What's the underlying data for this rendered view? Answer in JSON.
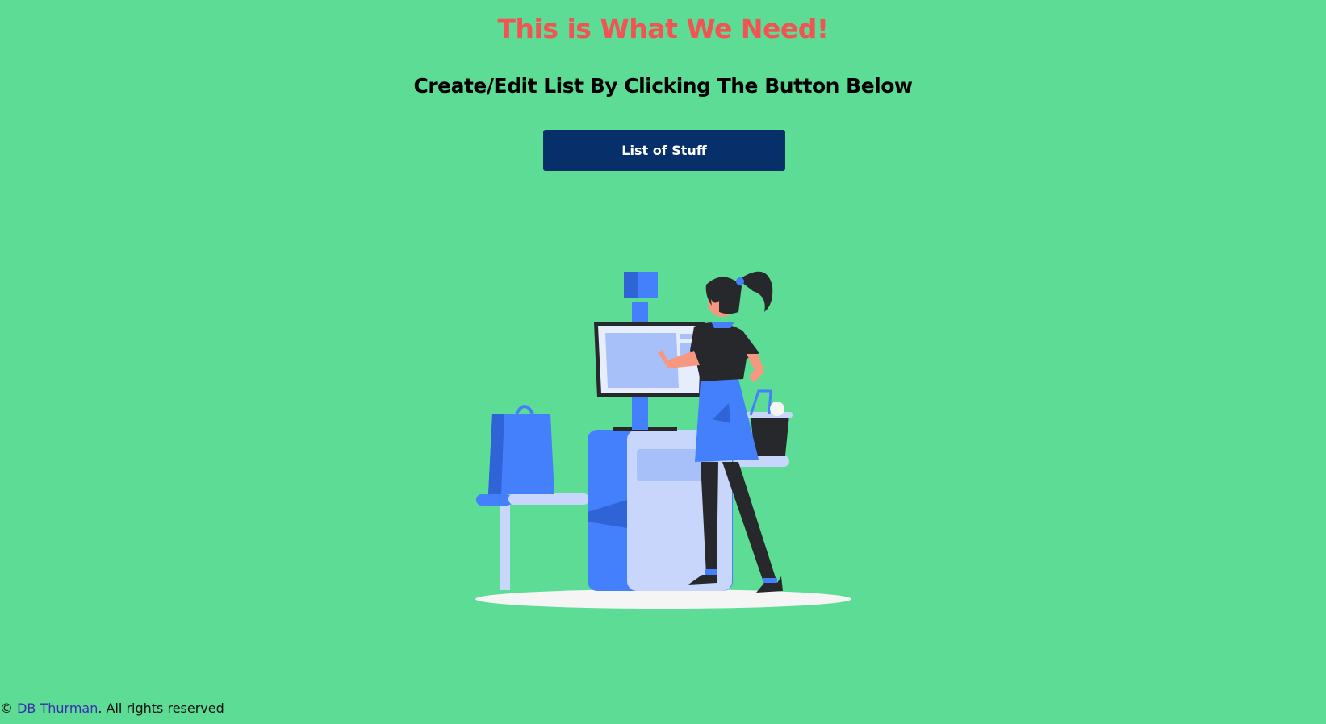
{
  "header": {
    "title": "This is What We Need!",
    "subtitle": "Create/Edit List By Clicking The Button Below"
  },
  "main": {
    "button_label": "List of Stuff"
  },
  "footer": {
    "copyright_symbol": "©",
    "author": "DB Thurman",
    "rights": ". All rights reserved"
  },
  "colors": {
    "background": "#5cdc95",
    "title": "#f25454",
    "button": "#07306a",
    "author_link": "#3a2fb0"
  },
  "illustration": {
    "icon": "self-checkout-woman-illustration"
  }
}
